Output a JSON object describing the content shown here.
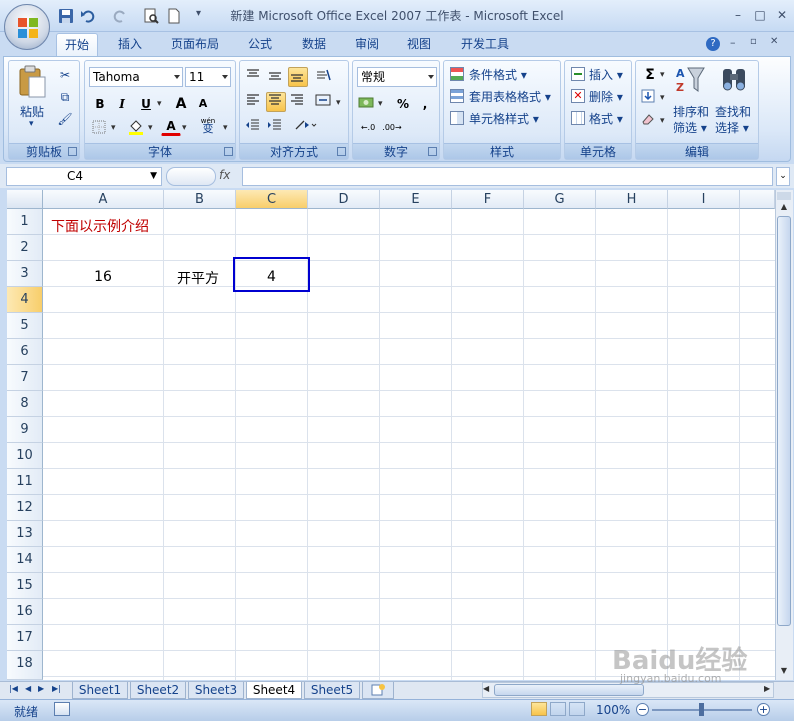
{
  "window": {
    "title": "新建 Microsoft Office Excel 2007 工作表 - Microsoft Excel",
    "min": "–",
    "max": "□",
    "close": "✕"
  },
  "ribbon_tabs": [
    "开始",
    "插入",
    "页面布局",
    "公式",
    "数据",
    "审阅",
    "视图",
    "开发工具"
  ],
  "active_tab": "开始",
  "clipboard": {
    "paste": "粘贴",
    "group": "剪贴板"
  },
  "font": {
    "name": "Tahoma",
    "size": "11",
    "bold": "B",
    "italic": "I",
    "underline": "U",
    "grow": "A",
    "shrink": "A",
    "wen": "wén",
    "wen_char": "变",
    "color_letter": "A",
    "group": "字体"
  },
  "alignment": {
    "group": "对齐方式"
  },
  "number": {
    "format": "常规",
    "percent": "%",
    "comma": ",",
    "inc_dec": ".0 .00",
    "group": "数字"
  },
  "styles": {
    "conditional": "条件格式",
    "table": "套用表格格式",
    "cell": "单元格样式",
    "group": "样式"
  },
  "cells": {
    "insert": "插入",
    "delete": "删除",
    "format": "格式",
    "group": "单元格"
  },
  "editing": {
    "sigma": "Σ",
    "sort_line1": "排序和",
    "sort_line2": "筛选",
    "find_line1": "查找和",
    "find_line2": "选择",
    "group": "编辑"
  },
  "formula_bar": {
    "name_box": "C4",
    "fx": "fx",
    "value": ""
  },
  "columns": [
    "A",
    "B",
    "C",
    "D",
    "E",
    "F",
    "G",
    "H",
    "I"
  ],
  "rows": [
    "1",
    "2",
    "3",
    "4",
    "5",
    "6",
    "7",
    "8",
    "9",
    "10",
    "11",
    "12",
    "13",
    "14",
    "15",
    "16",
    "17",
    "18"
  ],
  "cells_content": {
    "a1": "下面以示例介绍",
    "a3": "16",
    "b3": "开平方",
    "c3": "4"
  },
  "colors": {
    "red_text": "#c00000",
    "selection": "#0000d0",
    "accent": "#15428b"
  },
  "sheets": [
    "Sheet1",
    "Sheet2",
    "Sheet3",
    "Sheet4",
    "Sheet5"
  ],
  "active_sheet": "Sheet4",
  "status": {
    "text": "就绪",
    "zoom": "100%"
  },
  "watermark": {
    "brand": "Baidu经验",
    "url": "jingyan.baidu.com"
  }
}
